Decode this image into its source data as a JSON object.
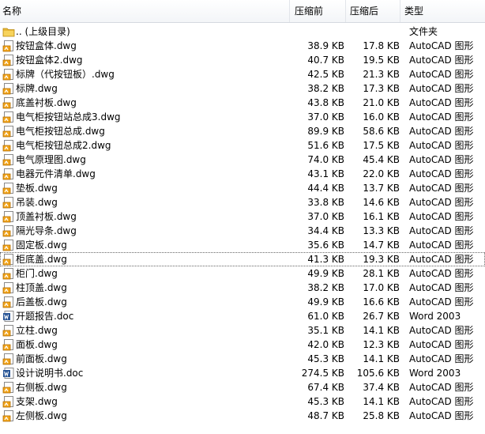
{
  "columns": {
    "name": "名称",
    "original": "压缩前",
    "compressed": "压缩后",
    "type": "类型"
  },
  "accent_colors": {
    "folder": "#e8b838",
    "dwg": "#f2a51a",
    "doc": "#2b5797"
  },
  "rows": [
    {
      "icon": "folder-up-icon",
      "name": ".. (上级目录)",
      "original": "",
      "compressed": "",
      "type": "文件夹"
    },
    {
      "icon": "dwg-file-icon",
      "name": "按钮盒体.dwg",
      "original": "38.9 KB",
      "compressed": "17.8 KB",
      "type": "AutoCAD 图形"
    },
    {
      "icon": "dwg-file-icon",
      "name": "按钮盒体2.dwg",
      "original": "40.7 KB",
      "compressed": "19.5 KB",
      "type": "AutoCAD 图形"
    },
    {
      "icon": "dwg-file-icon",
      "name": "标牌（代按钮板）.dwg",
      "original": "42.5 KB",
      "compressed": "21.3 KB",
      "type": "AutoCAD 图形"
    },
    {
      "icon": "dwg-file-icon",
      "name": "标牌.dwg",
      "original": "38.2 KB",
      "compressed": "17.3 KB",
      "type": "AutoCAD 图形"
    },
    {
      "icon": "dwg-file-icon",
      "name": "底盖衬板.dwg",
      "original": "43.8 KB",
      "compressed": "21.0 KB",
      "type": "AutoCAD 图形"
    },
    {
      "icon": "dwg-file-icon",
      "name": "电气柜按钮站总成3.dwg",
      "original": "37.0 KB",
      "compressed": "16.0 KB",
      "type": "AutoCAD 图形"
    },
    {
      "icon": "dwg-file-icon",
      "name": "电气柜按钮总成.dwg",
      "original": "89.9 KB",
      "compressed": "58.6 KB",
      "type": "AutoCAD 图形"
    },
    {
      "icon": "dwg-file-icon",
      "name": "电气柜按钮总成2.dwg",
      "original": "51.6 KB",
      "compressed": "17.5 KB",
      "type": "AutoCAD 图形"
    },
    {
      "icon": "dwg-file-icon",
      "name": "电气原理图.dwg",
      "original": "74.0 KB",
      "compressed": "45.4 KB",
      "type": "AutoCAD 图形"
    },
    {
      "icon": "dwg-file-icon",
      "name": "电器元件清单.dwg",
      "original": "43.1 KB",
      "compressed": "22.0 KB",
      "type": "AutoCAD 图形"
    },
    {
      "icon": "dwg-file-icon",
      "name": "垫板.dwg",
      "original": "44.4 KB",
      "compressed": "13.7 KB",
      "type": "AutoCAD 图形"
    },
    {
      "icon": "dwg-file-icon",
      "name": "吊装.dwg",
      "original": "33.8 KB",
      "compressed": "14.6 KB",
      "type": "AutoCAD 图形"
    },
    {
      "icon": "dwg-file-icon",
      "name": "顶盖衬板.dwg",
      "original": "37.0 KB",
      "compressed": "16.1 KB",
      "type": "AutoCAD 图形"
    },
    {
      "icon": "dwg-file-icon",
      "name": "隔光导条.dwg",
      "original": "34.4 KB",
      "compressed": "13.3 KB",
      "type": "AutoCAD 图形"
    },
    {
      "icon": "dwg-file-icon",
      "name": "固定板.dwg",
      "original": "35.6 KB",
      "compressed": "14.7 KB",
      "type": "AutoCAD 图形"
    },
    {
      "icon": "dwg-file-icon",
      "name": "柜底盖.dwg",
      "original": "41.3 KB",
      "compressed": "19.3 KB",
      "type": "AutoCAD 图形",
      "focused": true
    },
    {
      "icon": "dwg-file-icon",
      "name": "柜门.dwg",
      "original": "49.9 KB",
      "compressed": "28.1 KB",
      "type": "AutoCAD 图形"
    },
    {
      "icon": "dwg-file-icon",
      "name": "柱顶盖.dwg",
      "original": "38.2 KB",
      "compressed": "17.0 KB",
      "type": "AutoCAD 图形"
    },
    {
      "icon": "dwg-file-icon",
      "name": "后盖板.dwg",
      "original": "49.9 KB",
      "compressed": "16.6 KB",
      "type": "AutoCAD 图形"
    },
    {
      "icon": "word-doc-icon",
      "name": "开题报告.doc",
      "original": "61.0 KB",
      "compressed": "26.7 KB",
      "type": "Word 2003"
    },
    {
      "icon": "dwg-file-icon",
      "name": "立柱.dwg",
      "original": "35.1 KB",
      "compressed": "14.1 KB",
      "type": "AutoCAD 图形"
    },
    {
      "icon": "dwg-file-icon",
      "name": "面板.dwg",
      "original": "42.0 KB",
      "compressed": "12.3 KB",
      "type": "AutoCAD 图形"
    },
    {
      "icon": "dwg-file-icon",
      "name": "前面板.dwg",
      "original": "45.3 KB",
      "compressed": "14.1 KB",
      "type": "AutoCAD 图形"
    },
    {
      "icon": "word-doc-icon",
      "name": "设计说明书.doc",
      "original": "274.5 KB",
      "compressed": "105.6 KB",
      "type": "Word 2003"
    },
    {
      "icon": "dwg-file-icon",
      "name": "右侧板.dwg",
      "original": "67.4 KB",
      "compressed": "37.4 KB",
      "type": "AutoCAD 图形"
    },
    {
      "icon": "dwg-file-icon",
      "name": "支架.dwg",
      "original": "45.3 KB",
      "compressed": "14.1 KB",
      "type": "AutoCAD 图形"
    },
    {
      "icon": "dwg-file-icon",
      "name": "左侧板.dwg",
      "original": "48.7 KB",
      "compressed": "25.8 KB",
      "type": "AutoCAD 图形"
    }
  ]
}
